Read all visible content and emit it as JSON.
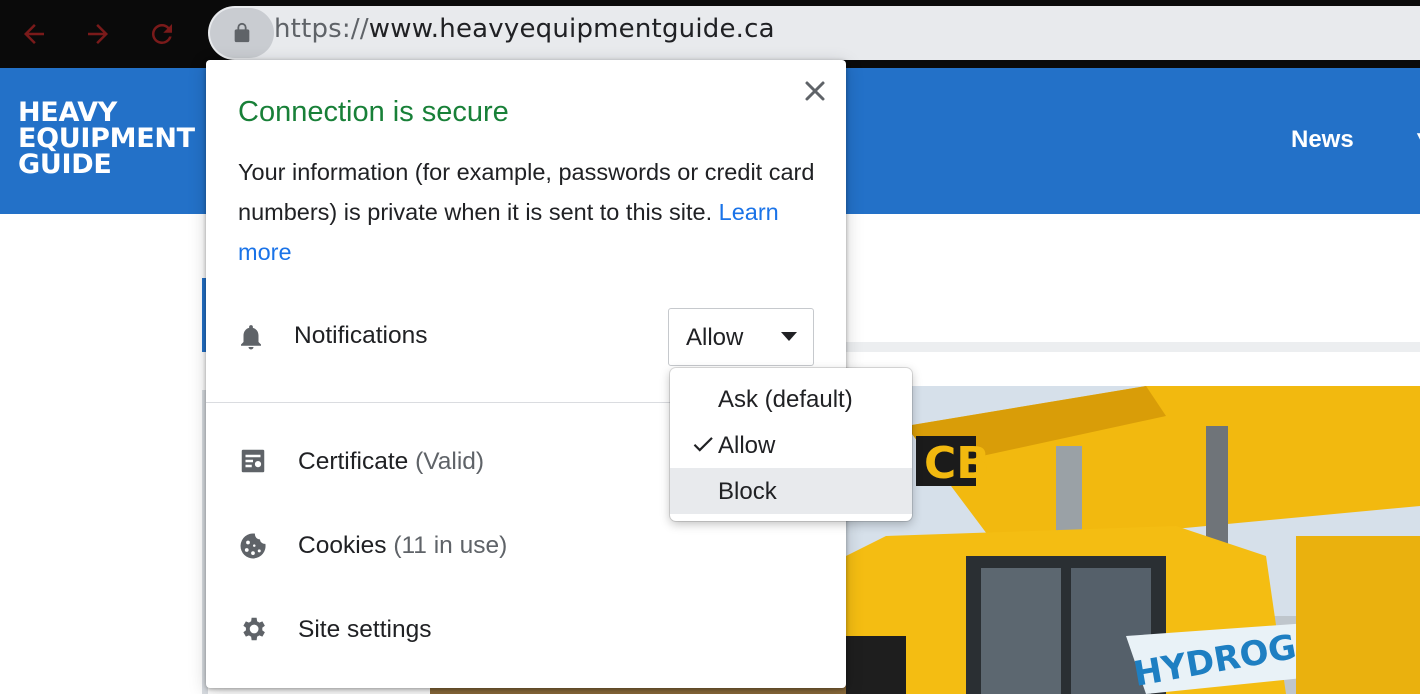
{
  "browser": {
    "url_scheme": "https://",
    "url_host": "www.heavyequipmentguide.ca"
  },
  "site": {
    "logo_lines": [
      "HEAVY",
      "EQUIPMENT",
      "GUIDE"
    ],
    "nav_items": [
      "News"
    ],
    "brand_color": "#2371c8"
  },
  "security_popup": {
    "title": "Connection is secure",
    "body_text": "Your information (for example, passwords or credit card numbers) is private when it is sent to this site.",
    "learn_more": "Learn more",
    "permission": {
      "label": "Notifications",
      "selected": "Allow"
    },
    "links": [
      {
        "label": "Certificate",
        "detail": "(Valid)",
        "icon": "certificate-icon"
      },
      {
        "label": "Cookies",
        "detail": "(11 in use)",
        "icon": "cookie-icon"
      },
      {
        "label": "Site settings",
        "detail": "",
        "icon": "gear-icon"
      }
    ],
    "title_color": "#188038",
    "link_color": "#1a73e8"
  },
  "dropdown_menu": {
    "options": [
      {
        "label": "Ask (default)",
        "checked": false,
        "highlighted": false
      },
      {
        "label": "Allow",
        "checked": true,
        "highlighted": false
      },
      {
        "label": "Block",
        "checked": false,
        "highlighted": true
      }
    ]
  }
}
